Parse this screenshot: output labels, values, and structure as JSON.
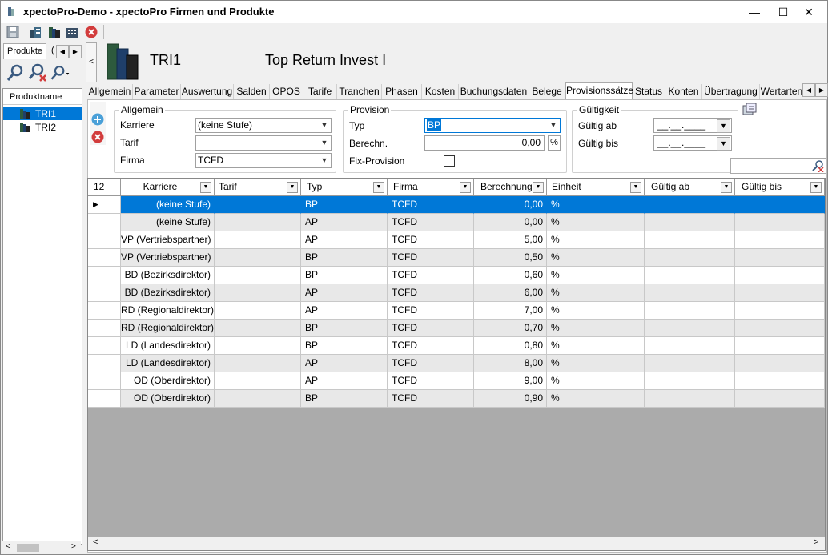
{
  "window": {
    "title": "xpectoPro-Demo - xpectoPro Firmen und Produkte",
    "minimize": "—",
    "maximize": "☐",
    "close": "✕"
  },
  "left": {
    "tabs": [
      "Produkte",
      "("
    ],
    "tree_header": "Produktname",
    "items": [
      {
        "label": "TRI1",
        "selected": true
      },
      {
        "label": "TRI2",
        "selected": false
      }
    ]
  },
  "header": {
    "code": "TRI1",
    "name": "Top Return Invest I"
  },
  "tabs": [
    {
      "label": "Allgemein"
    },
    {
      "label": "Parameter"
    },
    {
      "label": "Auswertung"
    },
    {
      "label": "Salden"
    },
    {
      "label": "OPOS"
    },
    {
      "label": "Tarife"
    },
    {
      "label": "Tranchen"
    },
    {
      "label": "Phasen"
    },
    {
      "label": "Kosten"
    },
    {
      "label": "Buchungsdaten"
    },
    {
      "label": "Belege"
    },
    {
      "label": "Provisionssätze"
    },
    {
      "label": "Status"
    },
    {
      "label": "Konten"
    },
    {
      "label": "Übertragung"
    },
    {
      "label": "Wertarten"
    }
  ],
  "form": {
    "allgemein": {
      "legend": "Allgemein",
      "karriere_label": "Karriere",
      "karriere_value": "(keine Stufe)",
      "tarif_label": "Tarif",
      "tarif_value": "",
      "firma_label": "Firma",
      "firma_value": "TCFD"
    },
    "provision": {
      "legend": "Provision",
      "typ_label": "Typ",
      "typ_value": "BP",
      "berechn_label": "Berechn.",
      "berechn_value": "0,00",
      "unit": "%",
      "fix_label": "Fix-Provision",
      "fix_checked": false
    },
    "gueltigkeit": {
      "legend": "Gültigkeit",
      "ab_label": "Gültig ab",
      "ab_value": "__.__.____",
      "bis_label": "Gültig bis",
      "bis_value": "__.__.____"
    }
  },
  "grid": {
    "count": "12",
    "columns": [
      "Karriere",
      "Tarif",
      "Typ",
      "Firma",
      "Berechnung",
      "Einheit",
      "Gültig ab",
      "Gültig bis"
    ],
    "rows": [
      [
        "(keine Stufe)",
        "",
        "BP",
        "TCFD",
        "0,00",
        "%",
        "",
        ""
      ],
      [
        "(keine Stufe)",
        "",
        "AP",
        "TCFD",
        "0,00",
        "%",
        "",
        ""
      ],
      [
        "VP (Vertriebspartner)",
        "",
        "AP",
        "TCFD",
        "5,00",
        "%",
        "",
        ""
      ],
      [
        "VP (Vertriebspartner)",
        "",
        "BP",
        "TCFD",
        "0,50",
        "%",
        "",
        ""
      ],
      [
        "BD (Bezirksdirektor)",
        "",
        "BP",
        "TCFD",
        "0,60",
        "%",
        "",
        ""
      ],
      [
        "BD (Bezirksdirektor)",
        "",
        "AP",
        "TCFD",
        "6,00",
        "%",
        "",
        ""
      ],
      [
        "RD (Regionaldirektor)",
        "",
        "AP",
        "TCFD",
        "7,00",
        "%",
        "",
        ""
      ],
      [
        "RD (Regionaldirektor)",
        "",
        "BP",
        "TCFD",
        "0,70",
        "%",
        "",
        ""
      ],
      [
        "LD (Landesdirektor)",
        "",
        "BP",
        "TCFD",
        "0,80",
        "%",
        "",
        ""
      ],
      [
        "LD (Landesdirektor)",
        "",
        "AP",
        "TCFD",
        "8,00",
        "%",
        "",
        ""
      ],
      [
        "OD (Oberdirektor)",
        "",
        "AP",
        "TCFD",
        "9,00",
        "%",
        "",
        ""
      ],
      [
        "OD (Oberdirektor)",
        "",
        "BP",
        "TCFD",
        "0,90",
        "%",
        "",
        ""
      ]
    ],
    "selected_row": 0
  },
  "colors": {
    "selection": "#0078d7",
    "row_alt": "#e8e8e8",
    "grid_bg": "#ababab"
  }
}
